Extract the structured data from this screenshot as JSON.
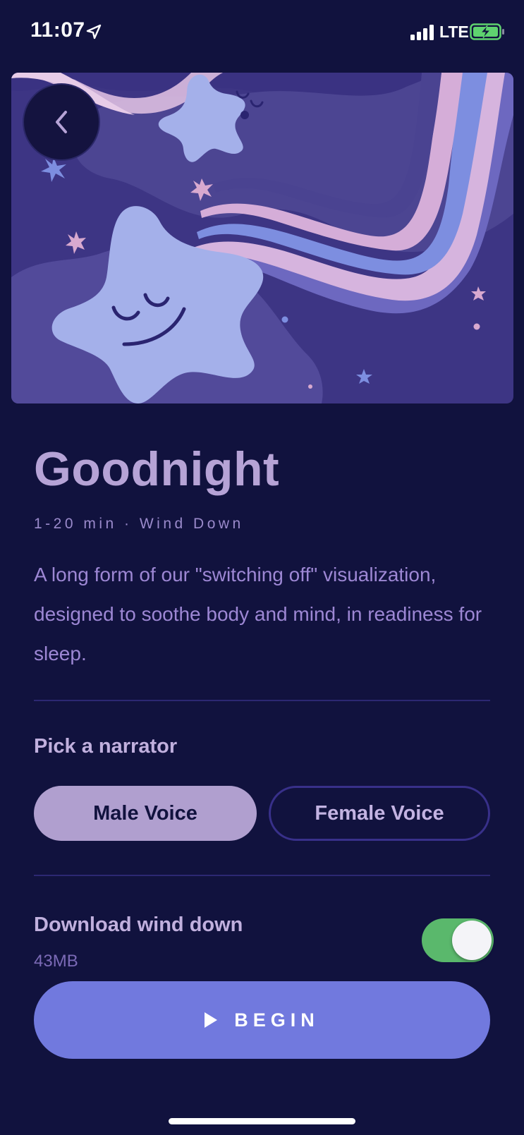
{
  "status_bar": {
    "time": "11:07",
    "network": "LTE"
  },
  "hero": {
    "image": "sleeping-stars-illustration"
  },
  "title": "Goodnight",
  "meta": "1-20 min · Wind Down",
  "description": "A long form of our \"switching off\" visualization, designed to soothe body and mind, in readiness for sleep.",
  "narrator": {
    "label": "Pick a narrator",
    "options": [
      "Male Voice",
      "Female Voice"
    ],
    "selected": "Male Voice"
  },
  "download": {
    "label": "Download wind down",
    "size": "43MB",
    "enabled": true
  },
  "begin_label": "BEGIN",
  "colors": {
    "background": "#11123e",
    "accent": "#7179de",
    "toggle_on": "#5ab86c",
    "title": "#b6a3d6"
  }
}
